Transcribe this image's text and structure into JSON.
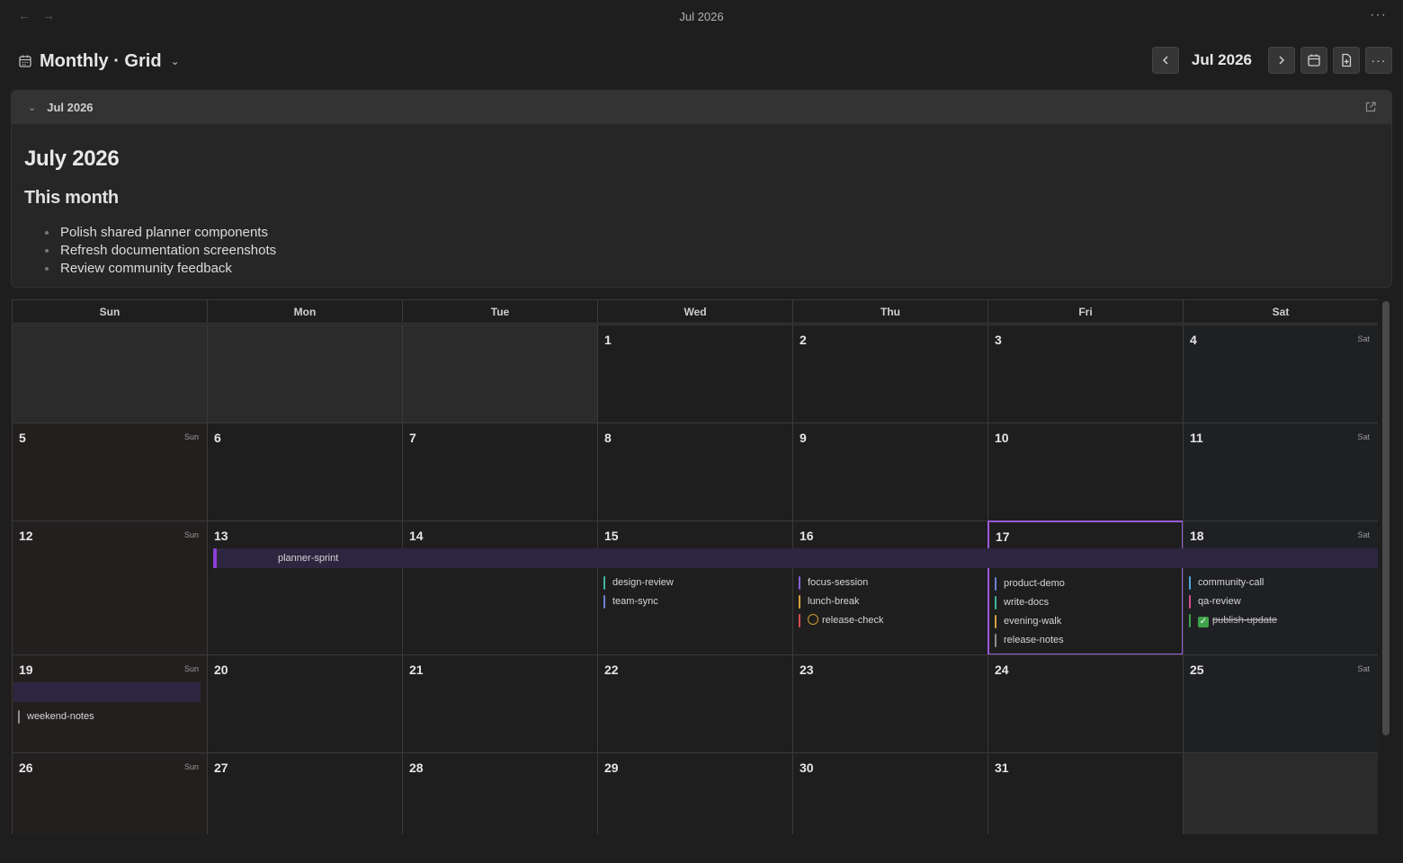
{
  "topbar": {
    "title": "Jul 2026",
    "back_icon": "arrow-left-icon",
    "forward_icon": "arrow-right-icon",
    "more_icon": "more-horizontal-icon"
  },
  "view": {
    "title": "Monthly · Grid",
    "icon": "calendar-icon",
    "dropdown_icon": "chevron-down-icon"
  },
  "controls": {
    "period_label": "Jul 2026",
    "prev_icon": "chevron-left-icon",
    "next_icon": "chevron-right-icon",
    "today_icon": "calendar-icon",
    "new_note_icon": "file-plus-icon",
    "more_icon": "more-horizontal-icon"
  },
  "note": {
    "header_label": "Jul 2026",
    "heading": "July 2026",
    "subheading": "This month",
    "items": [
      "Polish shared planner components",
      "Refresh documentation screenshots",
      "Review community feedback"
    ]
  },
  "calendar": {
    "weekdays": [
      "Sun",
      "Mon",
      "Tue",
      "Wed",
      "Thu",
      "Fri",
      "Sat"
    ],
    "day_tags": {
      "sun": "Sun",
      "sat": "Sat"
    },
    "today": 17,
    "multi_day_event": {
      "label": "planner-sprint",
      "start": 13,
      "end": 19
    },
    "weeks": [
      [
        null,
        null,
        null,
        1,
        2,
        3,
        4
      ],
      [
        5,
        6,
        7,
        8,
        9,
        10,
        11
      ],
      [
        12,
        13,
        14,
        15,
        16,
        17,
        18
      ],
      [
        19,
        20,
        21,
        22,
        23,
        24,
        25
      ],
      [
        26,
        27,
        28,
        29,
        30,
        31,
        null
      ]
    ],
    "events": {
      "15": [
        {
          "label": "design-review",
          "color": "#3fb5a0"
        },
        {
          "label": "team-sync",
          "color": "#6b7fd6"
        }
      ],
      "16": [
        {
          "label": "focus-session",
          "color": "#8a5fd6"
        },
        {
          "label": "lunch-break",
          "color": "#d6a13f"
        },
        {
          "label": "release-check",
          "color": "#d64f4f",
          "icon": "smiley-icon"
        }
      ],
      "17": [
        {
          "label": "product-demo",
          "color": "#6b7fd6"
        },
        {
          "label": "write-docs",
          "color": "#3fb5a0"
        },
        {
          "label": "evening-walk",
          "color": "#d6a13f"
        },
        {
          "label": "release-notes",
          "color": "#8f8f8f"
        }
      ],
      "18": [
        {
          "label": "community-call",
          "color": "#4fa6d6"
        },
        {
          "label": "qa-review",
          "color": "#d64f8f"
        },
        {
          "label": "publish-update",
          "color": "#3ea34b",
          "done": true,
          "icon": "check-icon"
        }
      ],
      "19": [
        {
          "label": "weekend-notes",
          "color": "#8f8f8f"
        }
      ]
    }
  }
}
